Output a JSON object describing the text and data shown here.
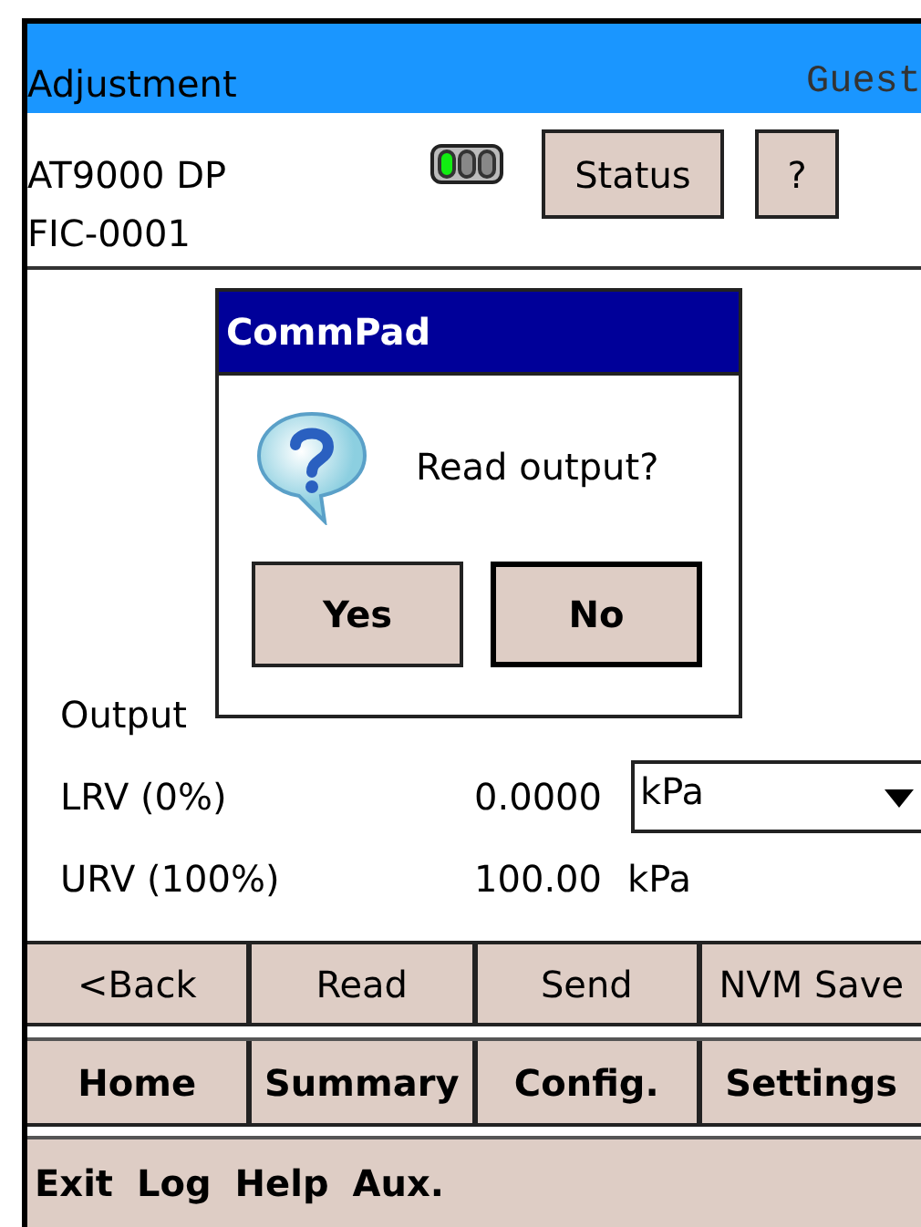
{
  "title_bar": {
    "title": "Adjustment",
    "user": "Guest"
  },
  "header": {
    "device": "AT9000 DP",
    "tag": "FIC-0001",
    "status_lights": [
      {
        "on": true
      },
      {
        "on": false
      },
      {
        "on": false
      }
    ],
    "buttons": [
      "Status",
      "?"
    ]
  },
  "fields": [
    {
      "kind": "text",
      "label": "Output"
    },
    {
      "kind": "select",
      "label": "LRV (0%)",
      "value": "0.0000",
      "unit": "kPa"
    },
    {
      "kind": "text",
      "label": "URV (100%)",
      "value": "100.00",
      "unit": "kPa"
    }
  ],
  "action_buttons": [
    "<Back",
    "Read",
    "Send",
    "NVM Save"
  ],
  "nav_buttons": [
    "Home",
    "Summary",
    "Config.",
    "Settings"
  ],
  "menu": [
    "Exit",
    "Log",
    "Help",
    "Aux."
  ],
  "dialog": {
    "title": "CommPad",
    "message": "Read output?",
    "buttons": [
      {
        "label": "Yes",
        "default": false
      },
      {
        "label": "No",
        "default": true
      }
    ]
  }
}
